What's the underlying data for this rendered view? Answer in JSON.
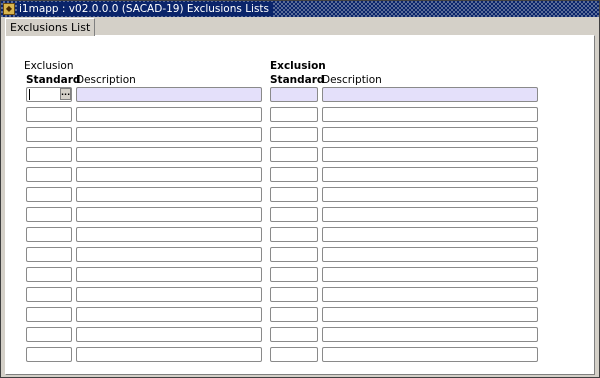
{
  "window": {
    "title": "i1mapp : v02.0.0.0 (SACAD-19) Exclusions Lists",
    "icon": "oracle-forms-app-icon"
  },
  "tab": {
    "label": "Exclusions List"
  },
  "columns": {
    "standard": "Standard",
    "description": "Description",
    "exclusion_line1": "Exclusion",
    "exclusion_line2": "Standard",
    "exclusion_description": "Description"
  },
  "lov_button": {
    "label": "..."
  },
  "rows": [
    {
      "standard": "",
      "description": "",
      "exclusion_standard": "",
      "exclusion_description": ""
    },
    {
      "standard": "",
      "description": "",
      "exclusion_standard": "",
      "exclusion_description": ""
    },
    {
      "standard": "",
      "description": "",
      "exclusion_standard": "",
      "exclusion_description": ""
    },
    {
      "standard": "",
      "description": "",
      "exclusion_standard": "",
      "exclusion_description": ""
    },
    {
      "standard": "",
      "description": "",
      "exclusion_standard": "",
      "exclusion_description": ""
    },
    {
      "standard": "",
      "description": "",
      "exclusion_standard": "",
      "exclusion_description": ""
    },
    {
      "standard": "",
      "description": "",
      "exclusion_standard": "",
      "exclusion_description": ""
    },
    {
      "standard": "",
      "description": "",
      "exclusion_standard": "",
      "exclusion_description": ""
    },
    {
      "standard": "",
      "description": "",
      "exclusion_standard": "",
      "exclusion_description": ""
    },
    {
      "standard": "",
      "description": "",
      "exclusion_standard": "",
      "exclusion_description": ""
    },
    {
      "standard": "",
      "description": "",
      "exclusion_standard": "",
      "exclusion_description": ""
    },
    {
      "standard": "",
      "description": "",
      "exclusion_standard": "",
      "exclusion_description": ""
    },
    {
      "standard": "",
      "description": "",
      "exclusion_standard": "",
      "exclusion_description": ""
    },
    {
      "standard": "",
      "description": "",
      "exclusion_standard": "",
      "exclusion_description": ""
    }
  ],
  "colors": {
    "titlebar": "#0a246a",
    "active_row": "#e4e0fa",
    "background": "#d4d0c8"
  }
}
